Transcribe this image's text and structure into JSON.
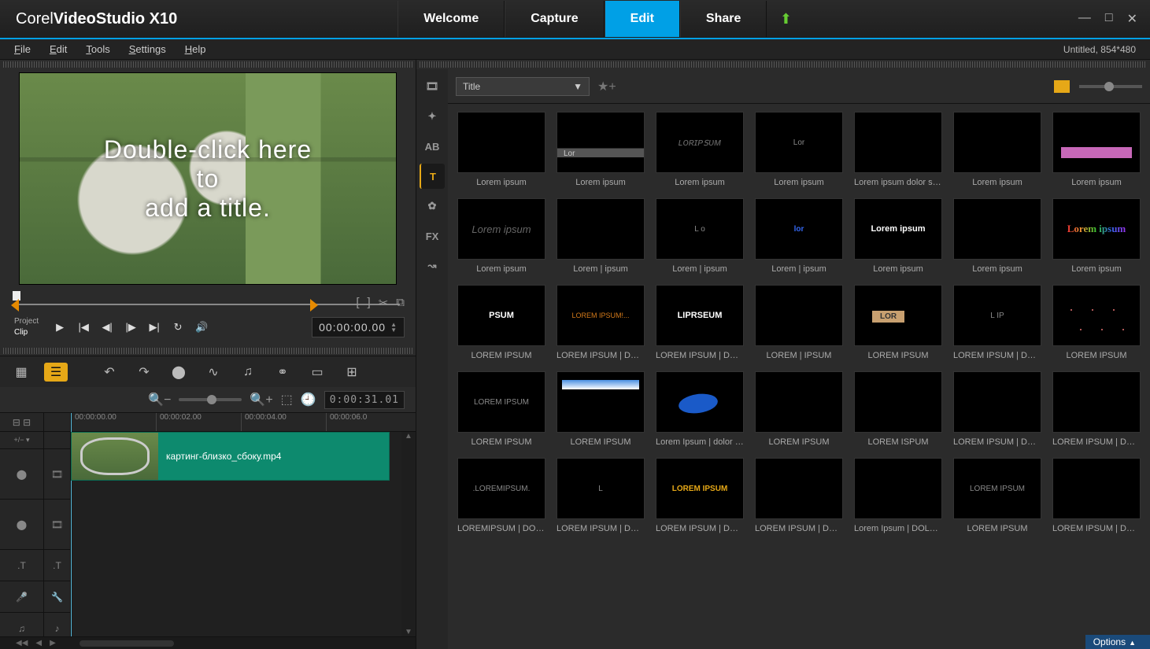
{
  "app": {
    "brand_thin": "Corel",
    "brand_bold": "VideoStudio",
    "brand_suffix": " X10"
  },
  "steps": {
    "welcome": "Welcome",
    "capture": "Capture",
    "edit": "Edit",
    "share": "Share"
  },
  "project_info": "Untitled, 854*480",
  "menus": {
    "file": "File",
    "edit": "Edit",
    "tools": "Tools",
    "settings": "Settings",
    "help": "Help"
  },
  "preview": {
    "overlay_l1": "Double-click here",
    "overlay_l2": "to",
    "overlay_l3": "add a title."
  },
  "transport": {
    "mode_project": "Project",
    "mode_clip": "Clip",
    "timecode": "00:00:00.00"
  },
  "timeline": {
    "toolbar_tc": "0:00:31.01",
    "ruler": [
      "00:00:00.00",
      "00:00:02.00",
      "00:00:04.00",
      "00:00:06.0"
    ],
    "clip_name": "картинг-близко_сбоку.mp4"
  },
  "library": {
    "dropdown": "Title",
    "items": [
      {
        "label": "Lorem ipsum",
        "cls": ""
      },
      {
        "label": "Lorem ipsum",
        "cls": "t-bar"
      },
      {
        "label": "Lorem ipsum",
        "cls": "t-italic",
        "txt": "ʟᴏʀɪᴘꜱᴜᴍ"
      },
      {
        "label": "Lorem ipsum",
        "cls": "",
        "txt": "Lor"
      },
      {
        "label": "Lorem ipsum dolor sit a...",
        "cls": ""
      },
      {
        "label": "Lorem ipsum",
        "cls": ""
      },
      {
        "label": "Lorem ipsum",
        "cls": "t-pink"
      },
      {
        "label": "Lorem ipsum",
        "cls": "t-italic",
        "txt": "Lorem ipsum"
      },
      {
        "label": "Lorem | ipsum",
        "cls": ""
      },
      {
        "label": "Lorem | ipsum",
        "cls": "",
        "txt": "L   o"
      },
      {
        "label": "Lorem | ipsum",
        "cls": "t-blue",
        "txt": "lor"
      },
      {
        "label": "Lorem ipsum",
        "cls": "t-boldw",
        "txt": "Lorem ipsum"
      },
      {
        "label": "Lorem ipsum",
        "cls": ""
      },
      {
        "label": "Lorem ipsum",
        "cls": "t-rainbow",
        "txt": "Lorem ipsum"
      },
      {
        "label": "LOREM IPSUM",
        "cls": "t-boldw",
        "txt": "PSUM"
      },
      {
        "label": "LOREM IPSUM | DOL...",
        "cls": "t-orange",
        "txt": "LOREM IPSUM!..."
      },
      {
        "label": "LOREM IPSUM | DOL...",
        "cls": "t-boldw",
        "txt": "LIPRSEUM"
      },
      {
        "label": "LOREM | IPSUM",
        "cls": ""
      },
      {
        "label": "LOREM IPSUM",
        "cls": "t-tan"
      },
      {
        "label": "LOREM IPSUM | DOL...",
        "cls": "",
        "txt": "L     IP"
      },
      {
        "label": "LOREM IPSUM",
        "cls": "t-dots"
      },
      {
        "label": "LOREM IPSUM",
        "cls": "",
        "txt": "LOREM IPSUM"
      },
      {
        "label": "LOREM IPSUM",
        "cls": "t-skybar"
      },
      {
        "label": "Lorem Ipsum |  dolor sit ...",
        "cls": "t-ellipse"
      },
      {
        "label": "LOREM IPSUM",
        "cls": ""
      },
      {
        "label": "LOREM ISPUM",
        "cls": ""
      },
      {
        "label": "LOREM IPSUM | DOL...",
        "cls": ""
      },
      {
        "label": "LOREM IPSUM | DOL...",
        "cls": ""
      },
      {
        "label": "LOREMIPSUM | DOLO...",
        "cls": "",
        "txt": ".LOREMIPSUM."
      },
      {
        "label": "LOREM IPSUM | DOL...",
        "cls": "",
        "txt": "L"
      },
      {
        "label": "LOREM IPSUM | DOL...",
        "cls": "t-yellow",
        "txt": "LOREM IPSUM"
      },
      {
        "label": "LOREM IPSUM | DOL...",
        "cls": ""
      },
      {
        "label": "Lorem Ipsum | DOLOR ...",
        "cls": ""
      },
      {
        "label": "LOREM IPSUM",
        "cls": "",
        "txt": "LOREM IPSUM"
      },
      {
        "label": "LOREM IPSUM | DOL...",
        "cls": ""
      }
    ]
  },
  "options_btn": "Options"
}
